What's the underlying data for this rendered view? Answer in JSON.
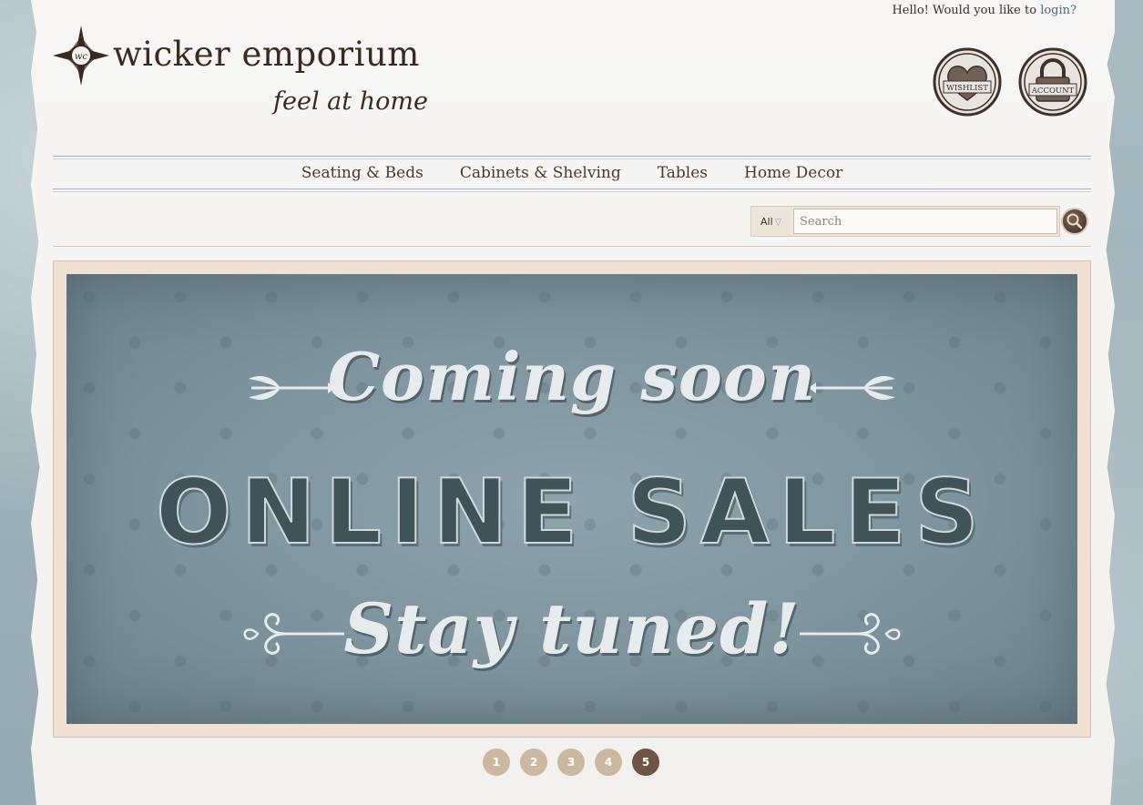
{
  "header": {
    "greeting": "Hello! Would you like to",
    "login_link": "login?",
    "brand_name": "wicker emporium",
    "tagline": "feel at home",
    "logo_monogram": "wc",
    "wishlist_label": "WISHLIST",
    "account_label": "ACCOUNT"
  },
  "nav": {
    "items": [
      "Seating & Beds",
      "Cabinets & Shelving",
      "Tables",
      "Home Decor"
    ]
  },
  "search": {
    "scope": "All",
    "placeholder": "Search",
    "value": ""
  },
  "banner": {
    "line1": "Coming soon",
    "line2": "ONLINE SALES",
    "line3": "Stay tuned!"
  },
  "pager": {
    "pages": [
      "1",
      "2",
      "3",
      "4",
      "5"
    ],
    "active_index": 4
  },
  "colors": {
    "brand_brown": "#3b2a20",
    "link_blue": "#4a6a86",
    "banner_blue": "#7e949c",
    "pager_dot": "#cbb8a0",
    "pager_active": "#6d5443"
  },
  "icons": {
    "logo": "compass-star-icon",
    "wishlist": "heart-stamp-icon",
    "account": "padlock-stamp-icon",
    "search": "magnifier-icon"
  }
}
